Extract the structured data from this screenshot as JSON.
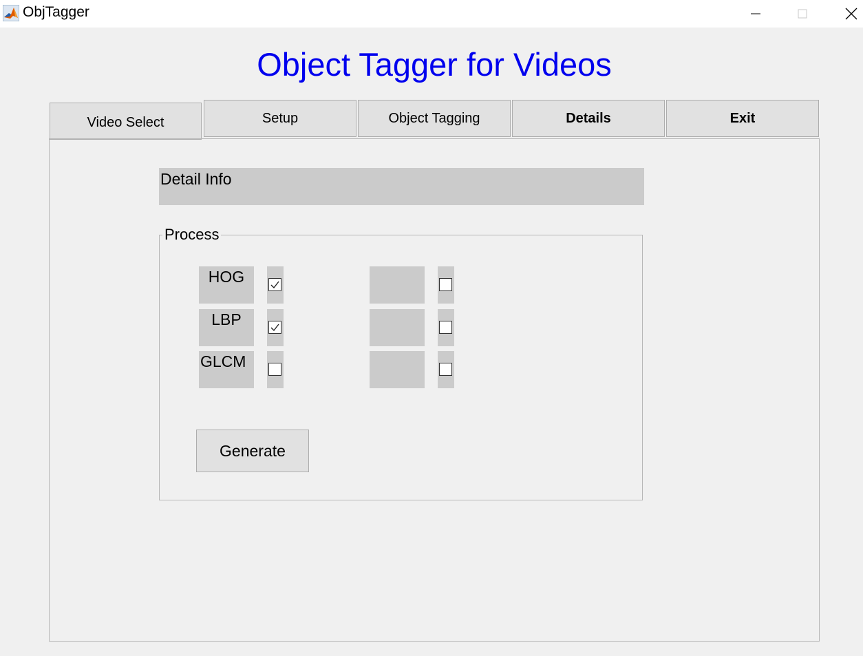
{
  "window": {
    "title": "ObjTagger"
  },
  "heading": "Object Tagger for Videos",
  "tabs": [
    {
      "label": "Video Select"
    },
    {
      "label": "Setup"
    },
    {
      "label": "Object Tagging"
    },
    {
      "label": "Details"
    },
    {
      "label": "Exit"
    }
  ],
  "detail_info": "Detail Info",
  "process": {
    "title": "Process",
    "features": [
      {
        "label": "HOG",
        "checked": true
      },
      {
        "label": "LBP",
        "checked": true
      },
      {
        "label": "GLCM",
        "checked": false
      }
    ],
    "extra": [
      {
        "label": "",
        "checked": false
      },
      {
        "label": "",
        "checked": false
      },
      {
        "label": "",
        "checked": false
      }
    ],
    "generate_label": "Generate"
  },
  "colors": {
    "heading": "#0000ee",
    "background": "#f0f0f0",
    "label_bg": "#cbcbcb",
    "button_bg": "#e1e1e1"
  }
}
